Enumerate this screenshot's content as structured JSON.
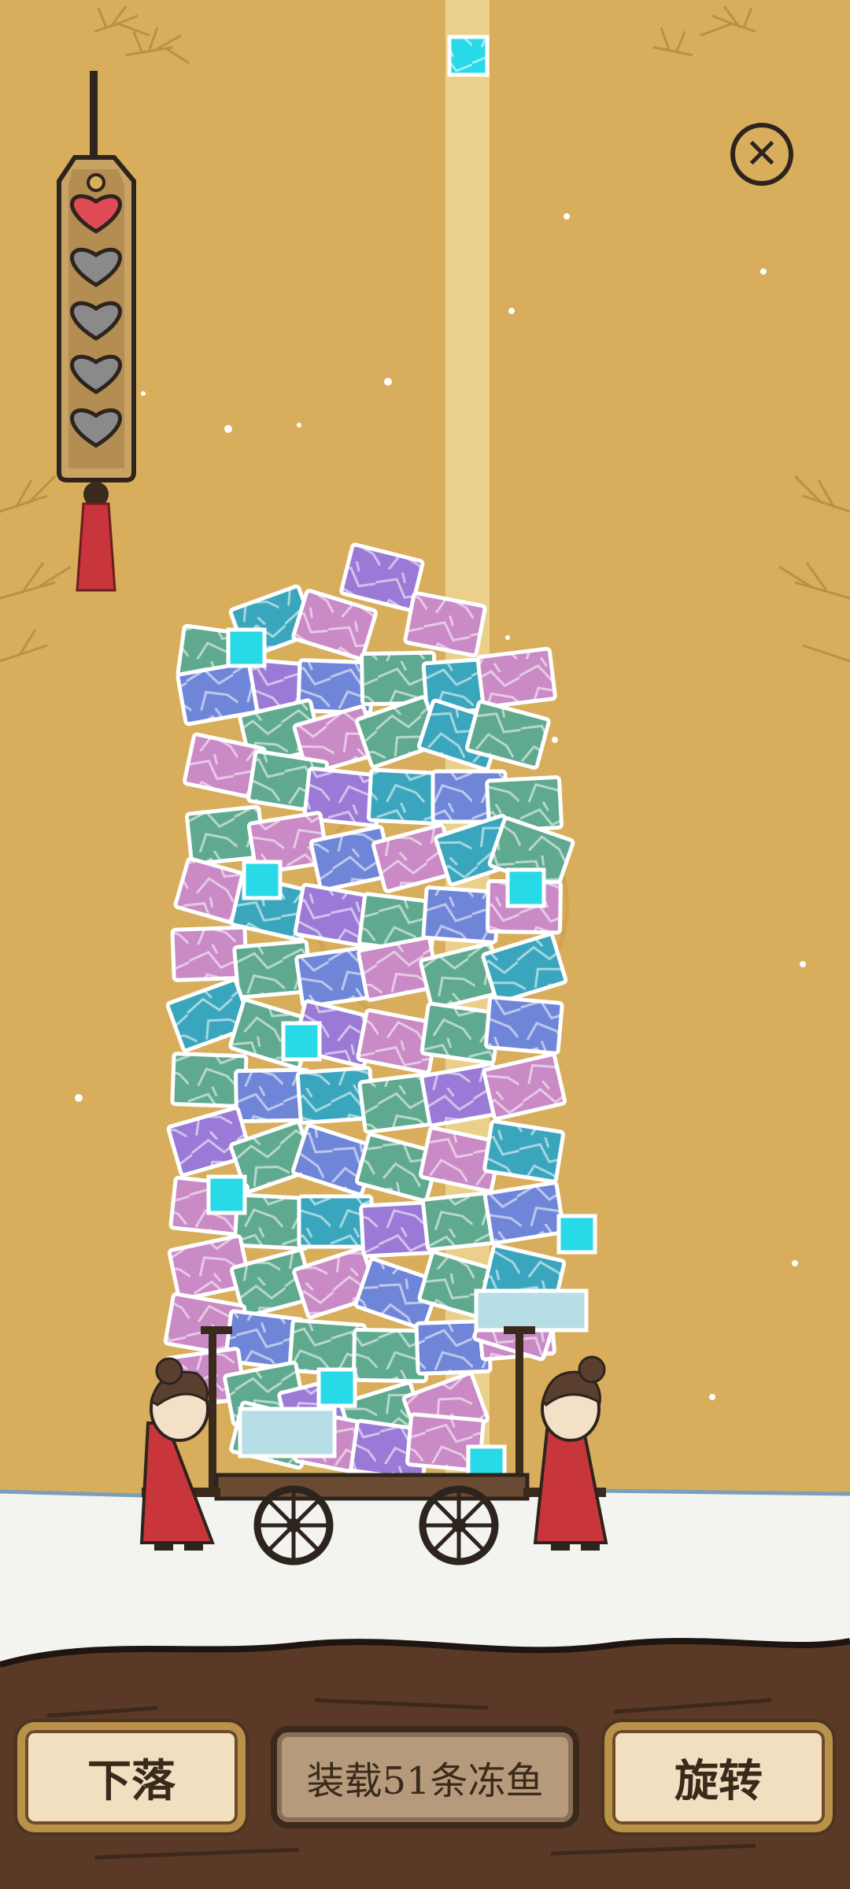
{
  "controls": {
    "drop_label": "下落",
    "rotate_label": "旋转",
    "goal_text": "装载51条冻鱼"
  },
  "lives": {
    "total": 5,
    "remaining": 1
  },
  "icons": {
    "close": "close-icon",
    "heart_full": "heart-icon",
    "heart_empty": "heart-empty-icon",
    "frozen_fish_block": "fish-block-icon"
  },
  "colors": {
    "background": "#d8ae5c",
    "beam": "#ead08a",
    "heart_full": "#e04a55",
    "heart_empty": "#8a8a8a",
    "block_purple": "#9a7ad6",
    "block_pink": "#c98ac5",
    "block_green": "#5fa98f",
    "block_teal": "#3aa6bd",
    "block_blue": "#6f86d8",
    "block_pale": "#b7dde6",
    "block_cyan_bright": "#28d9e8",
    "snow": "#f3f3f0",
    "ground": "#5a3a27",
    "character_robe": "#c8353a"
  }
}
